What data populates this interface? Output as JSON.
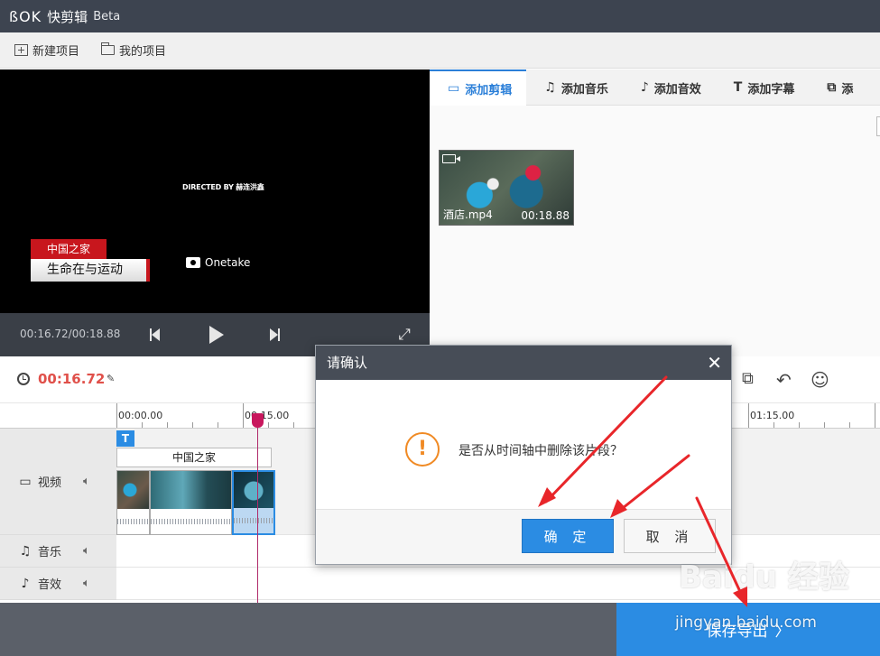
{
  "app": {
    "logo": "ßOK",
    "title": "快剪辑",
    "badge": "Beta"
  },
  "menu": {
    "new_project": "新建项目",
    "my_projects": "我的项目"
  },
  "preview": {
    "credit_text": "DIRECTED BY 赫连洪鑫",
    "lower_third_top": "中国之家",
    "lower_third_bottom": "生命在与运动",
    "brand_text": "Onetake"
  },
  "player": {
    "time_readout": "00:16.72/00:18.88"
  },
  "tabs": [
    {
      "label": "添加剪辑",
      "icon": "video-camera-icon"
    },
    {
      "label": "添加音乐",
      "icon": "music-note-icon"
    },
    {
      "label": "添加音效",
      "icon": "sound-effect-icon"
    },
    {
      "label": "添加字幕",
      "icon": "text-icon"
    },
    {
      "label": "添",
      "icon": "copy-icon"
    }
  ],
  "media": [
    {
      "name": "酒店.mp4",
      "duration": "00:18.88"
    }
  ],
  "timeline": {
    "current_time": "00:16.72",
    "ruler_labels": [
      "00:00.00",
      "00:15.00",
      "01:15.00"
    ],
    "subtitle_clip": "中国之家",
    "tracks": [
      {
        "label": "视频",
        "icon": "video-camera-icon"
      },
      {
        "label": "音乐",
        "icon": "music-note-icon"
      },
      {
        "label": "音效",
        "icon": "sound-effect-icon"
      }
    ]
  },
  "dialog": {
    "title": "请确认",
    "message": "是否从时间轴中删除该片段？",
    "ok_label": "确 定",
    "cancel_label": "取 消"
  },
  "export": {
    "label": "保存导出",
    "arrow": "〉"
  },
  "watermark": {
    "text": "Baidu 经验",
    "sub": "jingyan.baidu.com"
  },
  "colors": {
    "accent": "#2b8ce3",
    "time_red": "#e0504a",
    "warning": "#f08a24",
    "title_bar": "#3d4450",
    "arrow_red": "#e8262a"
  }
}
